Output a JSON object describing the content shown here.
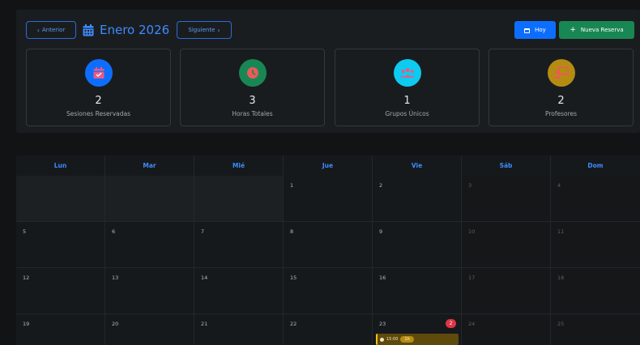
{
  "header": {
    "prev_label": "Anterior",
    "month_title": "Enero 2026",
    "next_label": "Siguiente",
    "today_label": "Hoy",
    "new_booking_label": "Nueva Reserva"
  },
  "stats": [
    {
      "value": "2",
      "label": "Sesiones Reservadas",
      "color": "#0d6efd",
      "icon": "calendar-check-icon"
    },
    {
      "value": "3",
      "label": "Horas Totales",
      "color": "#198754",
      "icon": "clock-icon"
    },
    {
      "value": "1",
      "label": "Grupos Únicos",
      "color": "#0dcaf0",
      "icon": "users-icon"
    },
    {
      "value": "2",
      "label": "Profesores",
      "color": "#b58c12",
      "icon": "teacher-icon"
    }
  ],
  "calendar": {
    "weekdays": [
      "Lun",
      "Mar",
      "Mié",
      "Jue",
      "Vie",
      "Sáb",
      "Dom"
    ],
    "days": [
      "1",
      "2",
      "3",
      "4",
      "5",
      "6",
      "7",
      "8",
      "9",
      "10",
      "11",
      "12",
      "13",
      "14",
      "15",
      "16",
      "17",
      "18",
      "19",
      "20",
      "21",
      "22",
      "23",
      "24",
      "25"
    ],
    "event": {
      "time": "15:00",
      "duration": "1h",
      "count": "2"
    }
  },
  "colors": {
    "accent": "#3d8bfd",
    "success": "#198754",
    "danger": "#dc3545",
    "warning": "#ffc107"
  }
}
